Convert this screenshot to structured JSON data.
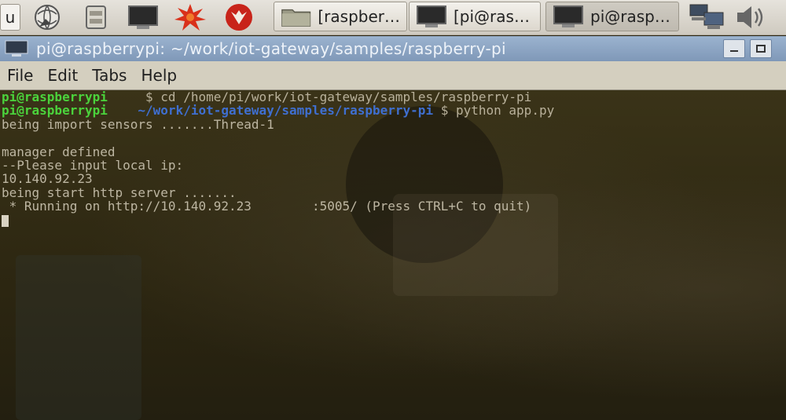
{
  "taskbar": {
    "menu_label": "u",
    "tasks": [
      {
        "label": "[raspber…",
        "icon": "folder-icon"
      },
      {
        "label": "[pi@ras…",
        "icon": "terminal-icon"
      },
      {
        "label": "pi@rasp…",
        "icon": "terminal-icon"
      }
    ]
  },
  "window": {
    "title": "pi@raspberrypi: ~/work/iot-gateway/samples/raspberry-pi"
  },
  "menubar": {
    "items": [
      "File",
      "Edit",
      "Tabs",
      "Help"
    ]
  },
  "terminal": {
    "line1": {
      "prompt": "pi@raspberrypi",
      "path": "~",
      "sep": " $ ",
      "cmd": "cd /home/pi/work/iot-gateway/samples/raspberry-pi"
    },
    "line2": {
      "prompt": "pi@raspberrypi",
      "path": "~/work/iot-gateway/samples/raspberry-pi",
      "sep": " $ ",
      "cmd": "python app.py"
    },
    "output": [
      "being import sensors .......Thread-1",
      "",
      "manager defined",
      "--Please input local ip:",
      "10.140.92.23",
      "being start http server .......",
      " * Running on http://10.140.92.23        :5005/ (Press CTRL+C to quit)"
    ]
  },
  "colors": {
    "prompt": "#4bd33c",
    "path": "#3f6fd0",
    "titlebar": "#8ea6c4"
  }
}
